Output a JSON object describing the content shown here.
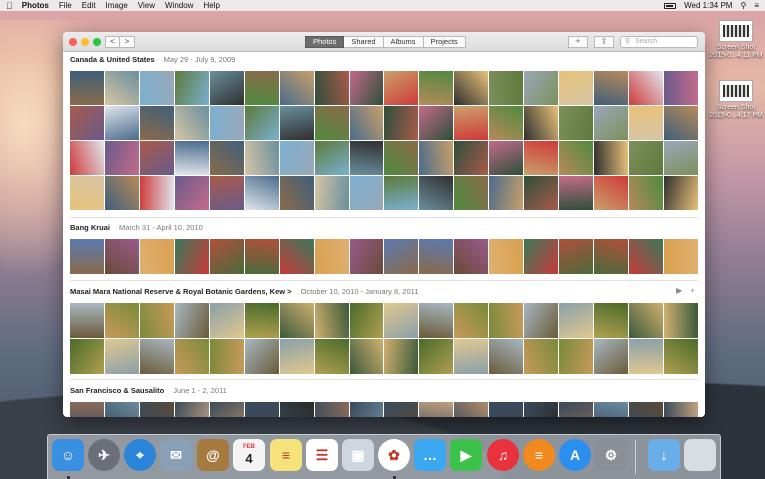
{
  "menubar": {
    "apple_glyph": "",
    "items": [
      "Photos",
      "File",
      "Edit",
      "Image",
      "View",
      "Window",
      "Help"
    ],
    "clock": "Wed 1:34 PM"
  },
  "desktop": {
    "icons": [
      {
        "label_line1": "Screen Shot",
        "label_line2": "2015-0...4.11 PM"
      },
      {
        "label_line1": "Screen Shot",
        "label_line2": "2015-0...4.17 PM"
      }
    ]
  },
  "window": {
    "nav": {
      "back_label": "<",
      "forward_label": ">"
    },
    "tabs": [
      {
        "label": "Photos",
        "active": true
      },
      {
        "label": "Shared",
        "active": false
      },
      {
        "label": "Albums",
        "active": false
      },
      {
        "label": "Projects",
        "active": false
      }
    ],
    "add_label": "+",
    "share_label": "⇪",
    "search_placeholder": "Search"
  },
  "moments": [
    {
      "title": "Canada & United States",
      "dates": "May 29 - July 9, 2009",
      "rows": 4,
      "palette": [
        "#8b6b4a",
        "#5d7a3b",
        "#4a6b8c",
        "#c9a06a",
        "#7d8f5c",
        "#3f5f7a",
        "#a85a4a",
        "#d6c5a5",
        "#6a8f9e",
        "#2e4f3a",
        "#b88a5a",
        "#9aa8b8",
        "#cf3a3a",
        "#e0e6ee",
        "#7ab0d0",
        "#4f8a3f",
        "#c46b8a",
        "#2f2f2f",
        "#e9c27a",
        "#6a5a8c"
      ]
    },
    {
      "title": "Bang Kruai",
      "dates": "March 31 - April 10, 2010",
      "rows": 1,
      "palette": [
        "#6a4a3a",
        "#b0503a",
        "#d9a050",
        "#8a6a4a",
        "#3a7a5a",
        "#c83a3a",
        "#5a7ab0",
        "#e0b070",
        "#4a6a3a",
        "#9a5a8a"
      ]
    },
    {
      "title": "Masai Mara National Reserve & Royal Botanic Gardens, Kew",
      "title_suffix": ">",
      "dates": "October 10, 2010 - January 8, 2011",
      "rows": 2,
      "palette": [
        "#7a8a3a",
        "#b0a050",
        "#4a6a2a",
        "#c89a5a",
        "#8aa0a8",
        "#d0b070",
        "#6a5a3a",
        "#a8b8c0",
        "#3a5a3a",
        "#e0c890"
      ]
    },
    {
      "title": "San Francisco & Sausalito",
      "dates": "June 1 - 2, 2011",
      "rows": 1,
      "palette": [
        "#5a4a3a",
        "#8a6a5a",
        "#3a4a5a",
        "#c0a080",
        "#6a8aa0",
        "#2a2a2a",
        "#b08a6a"
      ]
    }
  ],
  "moment_actions": {
    "slideshow_icon": "▶",
    "add_icon": "+"
  },
  "dock": {
    "apps": [
      {
        "name": "finder",
        "color": "#3b8fe0",
        "glyph": "☺"
      },
      {
        "name": "launchpad",
        "color": "#6a6f78",
        "glyph": "✈"
      },
      {
        "name": "safari",
        "color": "#2a84d8",
        "glyph": "⌖"
      },
      {
        "name": "mail",
        "color": "#8aa0b8",
        "glyph": "✉"
      },
      {
        "name": "contacts",
        "color": "#a6793f",
        "glyph": "@"
      },
      {
        "name": "calendar",
        "color": "#f4f4f4",
        "glyph": "4"
      },
      {
        "name": "notes",
        "color": "#f6e27a",
        "glyph": "≡"
      },
      {
        "name": "reminders",
        "color": "#ffffff",
        "glyph": "☰"
      },
      {
        "name": "preview",
        "color": "#cfd6e0",
        "glyph": "▣"
      },
      {
        "name": "photos",
        "color": "#ffffff",
        "glyph": "✿"
      },
      {
        "name": "messages",
        "color": "#3aa8f0",
        "glyph": "…"
      },
      {
        "name": "facetime",
        "color": "#3cc14a",
        "glyph": "▶"
      },
      {
        "name": "itunes",
        "color": "#e8323e",
        "glyph": "♫"
      },
      {
        "name": "ibooks",
        "color": "#f08a1e",
        "glyph": "≡"
      },
      {
        "name": "app-store",
        "color": "#2b8ff0",
        "glyph": "A"
      },
      {
        "name": "system-preferences",
        "color": "#8a8f96",
        "glyph": "⚙"
      }
    ],
    "calendar_month": "FEB",
    "downloads": {
      "color": "#6aaee8",
      "glyph": "↓"
    },
    "trash": {
      "color": "#d8dde2",
      "glyph": " "
    }
  }
}
